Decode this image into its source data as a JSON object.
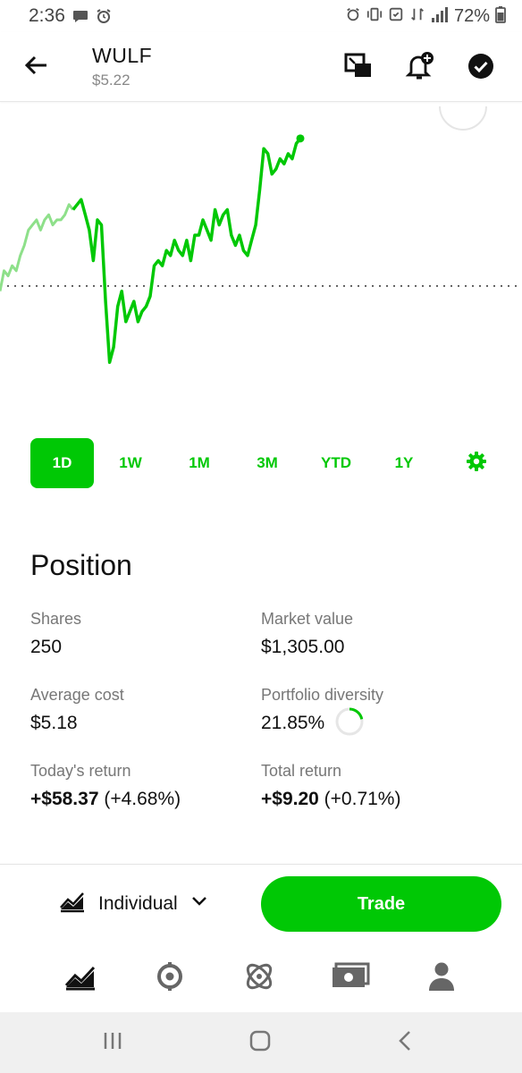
{
  "status_bar": {
    "time": "2:36",
    "battery": "72%"
  },
  "header": {
    "ticker": "WULF",
    "price": "$5.22"
  },
  "colors": {
    "accent": "#00c805",
    "accent_light": "#8ee08a",
    "text": "#111111",
    "muted": "#777777"
  },
  "icons": {
    "back": "back-arrow-icon",
    "compare": "compare-icon",
    "alert": "add-alert-icon",
    "watchlist": "check-circle-icon"
  },
  "chart_data": {
    "type": "line",
    "title": "",
    "xlabel": "",
    "ylabel": "",
    "ylim": [
      4.7,
      5.35
    ],
    "baseline": 4.99,
    "series": [
      {
        "values": [
          4.98,
          5.02,
          5.01,
          5.03,
          5.02,
          5.05,
          5.07,
          5.1,
          5.11,
          5.12,
          5.1,
          5.12,
          5.13,
          5.11,
          5.12,
          5.12,
          5.13,
          5.15,
          5.14,
          5.15,
          5.16,
          5.13,
          5.1,
          5.04,
          5.12,
          5.11,
          4.96,
          4.84,
          4.87,
          4.95,
          4.98,
          4.92,
          4.94,
          4.96,
          4.92,
          4.94,
          4.95,
          4.97,
          5.03,
          5.04,
          5.03,
          5.06,
          5.05,
          5.08,
          5.06,
          5.05,
          5.08,
          5.04,
          5.09,
          5.09,
          5.12,
          5.1,
          5.08,
          5.14,
          5.11,
          5.13,
          5.14,
          5.09,
          5.07,
          5.09,
          5.06,
          5.05,
          5.08,
          5.11,
          5.18,
          5.26,
          5.25,
          5.21,
          5.22,
          5.24,
          5.23,
          5.25,
          5.24,
          5.27,
          5.28
        ]
      }
    ],
    "premarket_points": 18,
    "grid": false,
    "legend": "none"
  },
  "ranges": {
    "items": [
      "1D",
      "1W",
      "1M",
      "3M",
      "YTD",
      "1Y"
    ],
    "active": "1D"
  },
  "position": {
    "title": "Position",
    "shares_label": "Shares",
    "shares": "250",
    "market_value_label": "Market value",
    "market_value": "$1,305.00",
    "avg_cost_label": "Average cost",
    "avg_cost": "$5.18",
    "diversity_label": "Portfolio diversity",
    "diversity": "21.85%",
    "diversity_fraction": 0.2185,
    "today_return_label": "Today's return",
    "today_return_amount": "+$58.37",
    "today_return_pct": "(+4.68%)",
    "total_return_label": "Total return",
    "total_return_amount": "+$9.20",
    "total_return_pct": "(+0.71%)"
  },
  "action_bar": {
    "account": "Individual",
    "trade": "Trade"
  }
}
